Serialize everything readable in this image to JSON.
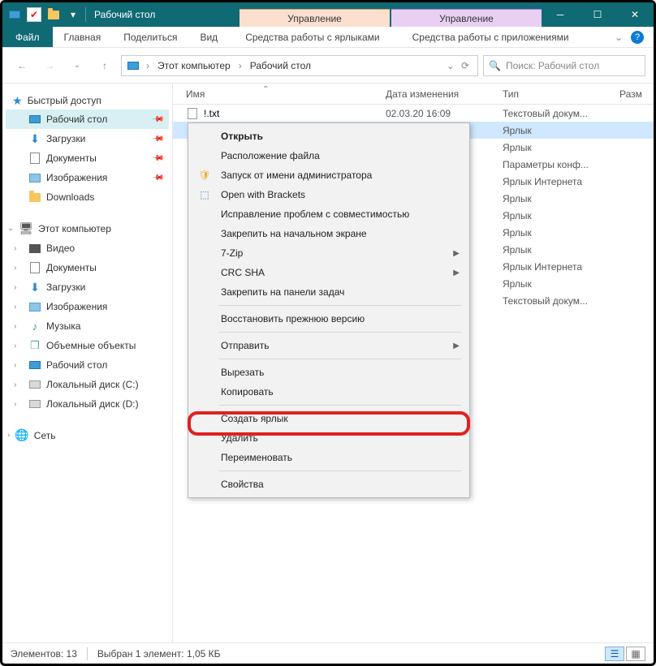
{
  "window": {
    "title": "Рабочий стол",
    "context_tabs": [
      "Управление",
      "Управление"
    ]
  },
  "ribbon": {
    "file": "Файл",
    "tabs": [
      "Главная",
      "Поделиться",
      "Вид",
      "Средства работы с ярлыками",
      "Средства работы с приложениями"
    ]
  },
  "address": {
    "segments": [
      "Этот компьютер",
      "Рабочий стол"
    ],
    "search_placeholder": "Поиск: Рабочий стол"
  },
  "nav": {
    "quick": {
      "label": "Быстрый доступ",
      "items": [
        {
          "label": "Рабочий стол",
          "pinned": true,
          "selected": true,
          "icon": "desktop"
        },
        {
          "label": "Загрузки",
          "pinned": true,
          "icon": "down"
        },
        {
          "label": "Документы",
          "pinned": true,
          "icon": "doc"
        },
        {
          "label": "Изображения",
          "pinned": true,
          "icon": "pic"
        },
        {
          "label": "Downloads",
          "pinned": false,
          "icon": "folder"
        }
      ]
    },
    "pc": {
      "label": "Этот компьютер",
      "items": [
        {
          "label": "Видео",
          "icon": "video"
        },
        {
          "label": "Документы",
          "icon": "doc"
        },
        {
          "label": "Загрузки",
          "icon": "down"
        },
        {
          "label": "Изображения",
          "icon": "pic"
        },
        {
          "label": "Музыка",
          "icon": "music"
        },
        {
          "label": "Объемные объекты",
          "icon": "cube"
        },
        {
          "label": "Рабочий стол",
          "icon": "desktop"
        },
        {
          "label": "Локальный диск (C:)",
          "icon": "disk"
        },
        {
          "label": "Локальный диск (D:)",
          "icon": "disk"
        }
      ]
    },
    "net": {
      "label": "Сеть"
    }
  },
  "columns": {
    "name": "Имя",
    "date": "Дата изменения",
    "type": "Тип",
    "size": "Разм"
  },
  "rows": [
    {
      "name": "!.txt",
      "date": "02.03.20 16:09",
      "type": "Текстовый докум...",
      "selected": false
    },
    {
      "name": "",
      "date": "",
      "type": "Ярлык",
      "selected": true
    },
    {
      "name": "",
      "date": "",
      "type": "Ярлык"
    },
    {
      "name": "",
      "date": "",
      "type": "Параметры конф..."
    },
    {
      "name": "",
      "date": "",
      "type": "Ярлык Интернета"
    },
    {
      "name": "",
      "date": "",
      "type": "Ярлык"
    },
    {
      "name": "",
      "date": "",
      "type": "Ярлык"
    },
    {
      "name": "",
      "date": "",
      "type": "Ярлык"
    },
    {
      "name": "",
      "date": "",
      "type": "Ярлык"
    },
    {
      "name": "",
      "date": "",
      "type": "Ярлык Интернета"
    },
    {
      "name": "",
      "date": "",
      "type": "Ярлык"
    },
    {
      "name": "",
      "date": "",
      "type": "Текстовый докум..."
    }
  ],
  "context_menu": [
    {
      "label": "Открыть",
      "bold": true
    },
    {
      "label": "Расположение файла"
    },
    {
      "label": "Запуск от имени администратора",
      "icon": "shield"
    },
    {
      "label": "Open with Brackets",
      "icon": "brackets"
    },
    {
      "label": "Исправление проблем с совместимостью"
    },
    {
      "label": "Закрепить на начальном экране"
    },
    {
      "label": "7-Zip",
      "submenu": true
    },
    {
      "label": "CRC SHA",
      "submenu": true
    },
    {
      "label": "Закрепить на панели задач"
    },
    {
      "sep": true
    },
    {
      "label": "Восстановить прежнюю версию"
    },
    {
      "sep": true
    },
    {
      "label": "Отправить",
      "submenu": true
    },
    {
      "sep": true
    },
    {
      "label": "Вырезать"
    },
    {
      "label": "Копировать"
    },
    {
      "sep": true
    },
    {
      "label": "Создать ярлык"
    },
    {
      "label": "Удалить"
    },
    {
      "label": "Переименовать"
    },
    {
      "sep": true
    },
    {
      "label": "Свойства",
      "highlight": true
    }
  ],
  "status": {
    "count_label": "Элементов: 13",
    "selection_label": "Выбран 1 элемент: 1,05 КБ"
  }
}
